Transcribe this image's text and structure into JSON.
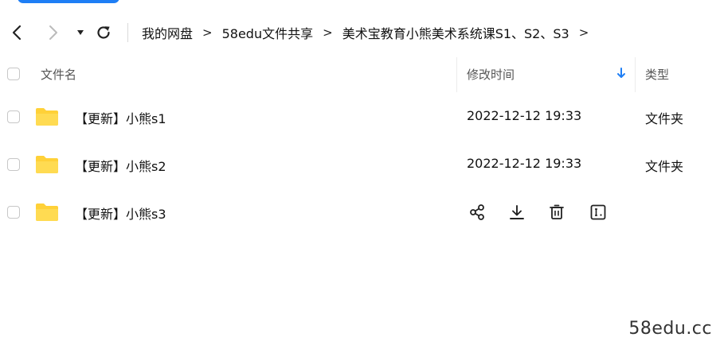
{
  "breadcrumb": {
    "items": [
      "我的网盘",
      "58edu文件共享",
      "美术宝教育小熊美术系统课S1、S2、S3"
    ],
    "separator": ">"
  },
  "table": {
    "headers": {
      "name": "文件名",
      "modified": "修改时间",
      "type": "类型"
    },
    "rows": [
      {
        "name": "【更新】小熊s1",
        "modified": "2022-12-12 19:33",
        "type": "文件夹"
      },
      {
        "name": "【更新】小熊s2",
        "modified": "2022-12-12 19:33",
        "type": "文件夹"
      },
      {
        "name": "【更新】小熊s3",
        "modified": "",
        "type": ""
      }
    ]
  },
  "icons": {
    "back": "chevron-left-icon",
    "forward": "chevron-right-icon",
    "history": "caret-down-icon",
    "refresh": "refresh-icon",
    "sort": "arrow-down-icon",
    "folder": "folder-icon",
    "share": "share-icon",
    "download": "download-icon",
    "delete": "trash-icon",
    "rename": "rename-icon"
  },
  "colors": {
    "accent": "#1e7ef5",
    "folder": "#ffd138",
    "text": "#111111",
    "muted": "#555555",
    "disabled": "#bbbbbb"
  },
  "watermark": "58edu.cc"
}
